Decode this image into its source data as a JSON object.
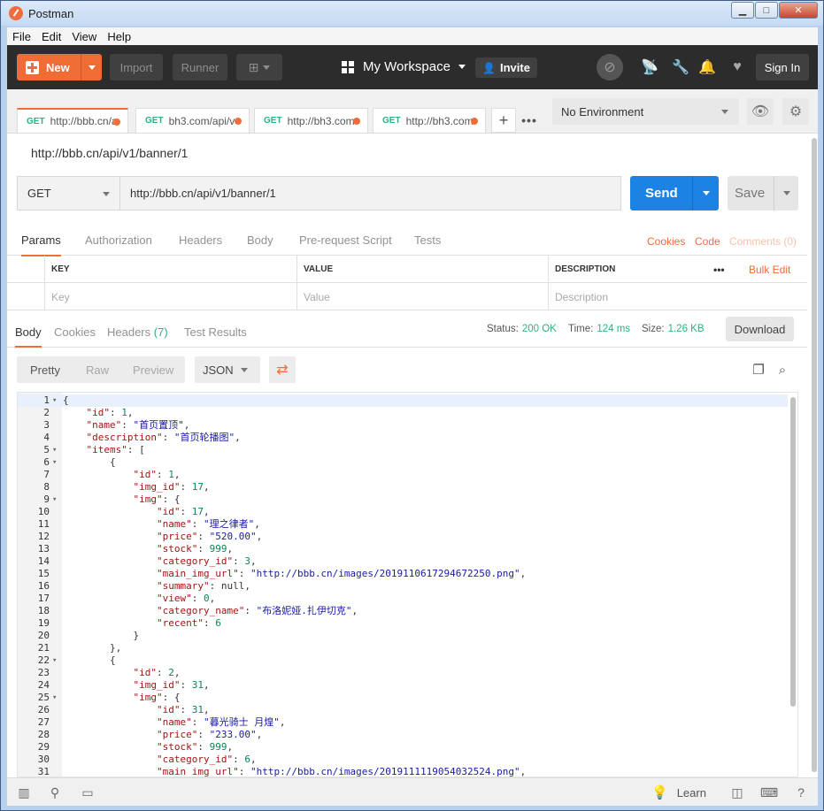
{
  "window": {
    "title": "Postman",
    "min": "▁",
    "max": "□",
    "close": "✕"
  },
  "menu": [
    "File",
    "Edit",
    "View",
    "Help"
  ],
  "header": {
    "new_label": "New",
    "import_label": "Import",
    "runner_label": "Runner",
    "workspace": "My Workspace",
    "invite_label": "Invite",
    "signin_label": "Sign In"
  },
  "tabs": [
    {
      "method": "GET",
      "label": "http://bbb.cn/a"
    },
    {
      "method": "GET",
      "label": "bh3.com/api/v"
    },
    {
      "method": "GET",
      "label": "http://bh3.com"
    },
    {
      "method": "GET",
      "label": "http://bh3.com"
    }
  ],
  "tab_more": "•••",
  "environment": "No Environment",
  "request": {
    "title": "http://bbb.cn/api/v1/banner/1",
    "method": "GET",
    "url": "http://bbb.cn/api/v1/banner/1",
    "send_label": "Send",
    "save_label": "Save"
  },
  "req_tabs": [
    "Params",
    "Authorization",
    "Headers",
    "Body",
    "Pre-request Script",
    "Tests"
  ],
  "req_links": {
    "cookies": "Cookies",
    "code": "Code",
    "comments": "Comments (0)"
  },
  "params": {
    "headers": {
      "key": "KEY",
      "value": "VALUE",
      "description": "DESCRIPTION",
      "more": "•••",
      "bulk_edit": "Bulk Edit"
    },
    "placeholders": {
      "key": "Key",
      "value": "Value",
      "description": "Description"
    }
  },
  "response": {
    "tabs": {
      "body": "Body",
      "cookies": "Cookies",
      "headers": "Headers",
      "headers_count": "(7)",
      "tests": "Test Results"
    },
    "status_label": "Status:",
    "status": "200 OK",
    "time_label": "Time:",
    "time": "124 ms",
    "size_label": "Size:",
    "size": "1.26 KB",
    "download_label": "Download",
    "formats": [
      "Pretty",
      "Raw",
      "Preview"
    ],
    "lang": "JSON"
  },
  "code_lines": [
    {
      "n": "1",
      "fold": true,
      "indent": 0,
      "parts": [
        [
          "p",
          "{"
        ]
      ]
    },
    {
      "n": "2",
      "indent": 1,
      "parts": [
        [
          "k",
          "\"id\""
        ],
        [
          "p",
          ": "
        ],
        [
          "n",
          "1"
        ],
        [
          "p",
          ","
        ]
      ]
    },
    {
      "n": "3",
      "indent": 1,
      "parts": [
        [
          "k",
          "\"name\""
        ],
        [
          "p",
          ": "
        ],
        [
          "s",
          "\"首页置顶\""
        ],
        [
          "p",
          ","
        ]
      ]
    },
    {
      "n": "4",
      "indent": 1,
      "parts": [
        [
          "k",
          "\"description\""
        ],
        [
          "p",
          ": "
        ],
        [
          "s",
          "\"首页轮播图\""
        ],
        [
          "p",
          ","
        ]
      ]
    },
    {
      "n": "5",
      "fold": true,
      "indent": 1,
      "parts": [
        [
          "k",
          "\"items\""
        ],
        [
          "p",
          ": ["
        ]
      ]
    },
    {
      "n": "6",
      "fold": true,
      "indent": 2,
      "parts": [
        [
          "p",
          "{"
        ]
      ]
    },
    {
      "n": "7",
      "indent": 3,
      "parts": [
        [
          "k",
          "\"id\""
        ],
        [
          "p",
          ": "
        ],
        [
          "n",
          "1"
        ],
        [
          "p",
          ","
        ]
      ]
    },
    {
      "n": "8",
      "indent": 3,
      "parts": [
        [
          "k",
          "\"img_id\""
        ],
        [
          "p",
          ": "
        ],
        [
          "n",
          "17"
        ],
        [
          "p",
          ","
        ]
      ]
    },
    {
      "n": "9",
      "fold": true,
      "indent": 3,
      "parts": [
        [
          "k",
          "\"img\""
        ],
        [
          "p",
          ": {"
        ]
      ]
    },
    {
      "n": "10",
      "indent": 4,
      "parts": [
        [
          "k",
          "\"id\""
        ],
        [
          "p",
          ": "
        ],
        [
          "n",
          "17"
        ],
        [
          "p",
          ","
        ]
      ]
    },
    {
      "n": "11",
      "indent": 4,
      "parts": [
        [
          "k",
          "\"name\""
        ],
        [
          "p",
          ": "
        ],
        [
          "s",
          "\"理之律者\""
        ],
        [
          "p",
          ","
        ]
      ]
    },
    {
      "n": "12",
      "indent": 4,
      "parts": [
        [
          "k",
          "\"price\""
        ],
        [
          "p",
          ": "
        ],
        [
          "s",
          "\"520.00\""
        ],
        [
          "p",
          ","
        ]
      ]
    },
    {
      "n": "13",
      "indent": 4,
      "parts": [
        [
          "k",
          "\"stock\""
        ],
        [
          "p",
          ": "
        ],
        [
          "n",
          "999"
        ],
        [
          "p",
          ","
        ]
      ]
    },
    {
      "n": "14",
      "indent": 4,
      "parts": [
        [
          "k",
          "\"category_id\""
        ],
        [
          "p",
          ": "
        ],
        [
          "n",
          "3"
        ],
        [
          "p",
          ","
        ]
      ]
    },
    {
      "n": "15",
      "indent": 4,
      "parts": [
        [
          "k",
          "\"main_img_url\""
        ],
        [
          "p",
          ": "
        ],
        [
          "s",
          "\"http://bbb.cn/images/2019110617294672250.png\""
        ],
        [
          "p",
          ","
        ]
      ]
    },
    {
      "n": "16",
      "indent": 4,
      "parts": [
        [
          "k",
          "\"summary\""
        ],
        [
          "p",
          ": null,"
        ]
      ]
    },
    {
      "n": "17",
      "indent": 4,
      "parts": [
        [
          "k",
          "\"view\""
        ],
        [
          "p",
          ": "
        ],
        [
          "n",
          "0"
        ],
        [
          "p",
          ","
        ]
      ]
    },
    {
      "n": "18",
      "indent": 4,
      "parts": [
        [
          "k",
          "\"category_name\""
        ],
        [
          "p",
          ": "
        ],
        [
          "s",
          "\"布洛妮娅.扎伊切克\""
        ],
        [
          "p",
          ","
        ]
      ]
    },
    {
      "n": "19",
      "indent": 4,
      "parts": [
        [
          "k",
          "\"recent\""
        ],
        [
          "p",
          ": "
        ],
        [
          "n",
          "6"
        ]
      ]
    },
    {
      "n": "20",
      "indent": 3,
      "parts": [
        [
          "p",
          "}"
        ]
      ]
    },
    {
      "n": "21",
      "indent": 2,
      "parts": [
        [
          "p",
          "},"
        ]
      ]
    },
    {
      "n": "22",
      "fold": true,
      "indent": 2,
      "parts": [
        [
          "p",
          "{"
        ]
      ]
    },
    {
      "n": "23",
      "indent": 3,
      "parts": [
        [
          "k",
          "\"id\""
        ],
        [
          "p",
          ": "
        ],
        [
          "n",
          "2"
        ],
        [
          "p",
          ","
        ]
      ]
    },
    {
      "n": "24",
      "indent": 3,
      "parts": [
        [
          "k",
          "\"img_id\""
        ],
        [
          "p",
          ": "
        ],
        [
          "n",
          "31"
        ],
        [
          "p",
          ","
        ]
      ]
    },
    {
      "n": "25",
      "fold": true,
      "indent": 3,
      "parts": [
        [
          "k",
          "\"img\""
        ],
        [
          "p",
          ": {"
        ]
      ]
    },
    {
      "n": "26",
      "indent": 4,
      "parts": [
        [
          "k",
          "\"id\""
        ],
        [
          "p",
          ": "
        ],
        [
          "n",
          "31"
        ],
        [
          "p",
          ","
        ]
      ]
    },
    {
      "n": "27",
      "indent": 4,
      "parts": [
        [
          "k",
          "\"name\""
        ],
        [
          "p",
          ": "
        ],
        [
          "s",
          "\"暮光骑士 月煌\""
        ],
        [
          "p",
          ","
        ]
      ]
    },
    {
      "n": "28",
      "indent": 4,
      "parts": [
        [
          "k",
          "\"price\""
        ],
        [
          "p",
          ": "
        ],
        [
          "s",
          "\"233.00\""
        ],
        [
          "p",
          ","
        ]
      ]
    },
    {
      "n": "29",
      "indent": 4,
      "parts": [
        [
          "k",
          "\"stock\""
        ],
        [
          "p",
          ": "
        ],
        [
          "n",
          "999"
        ],
        [
          "p",
          ","
        ]
      ]
    },
    {
      "n": "30",
      "indent": 4,
      "parts": [
        [
          "k",
          "\"category_id\""
        ],
        [
          "p",
          ": "
        ],
        [
          "n",
          "6"
        ],
        [
          "p",
          ","
        ]
      ]
    },
    {
      "n": "31",
      "indent": 4,
      "parts": [
        [
          "k",
          "\"main_img_url\""
        ],
        [
          "p",
          ": "
        ],
        [
          "s",
          "\"http://bbb.cn/images/2019111119054032524.png\""
        ],
        [
          "p",
          ","
        ]
      ]
    }
  ],
  "footer": {
    "learn_label": "Learn"
  },
  "colors": {
    "accent": "#f26b3a",
    "send": "#1c83e5",
    "success": "#26b47f"
  }
}
